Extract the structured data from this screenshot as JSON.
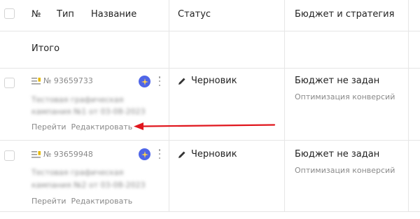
{
  "header": {
    "number_label": "№",
    "type_label": "Тип",
    "name_label": "Название",
    "status_label": "Статус",
    "budget_label": "Бюджет и стратегия"
  },
  "total_row": {
    "label": "Итого"
  },
  "campaigns": [
    {
      "id": "№ 93659733",
      "name_line1": "Тестовая графическая",
      "name_line2": "кампания №1 от 03-08-2023",
      "action_go": "Перейти",
      "action_edit": "Редактировать",
      "status": "Черновик",
      "budget": "Бюджет не задан",
      "strategy": "Оптимизация конверсий"
    },
    {
      "id": "№ 93659948",
      "name_line1": "Тестовая графическая",
      "name_line2": "кампания №2 от 03-08-2023",
      "action_go": "Перейти",
      "action_edit": "Редактировать",
      "status": "Черновик",
      "budget": "Бюджет не задан",
      "strategy": "Оптимизация конверсий"
    }
  ],
  "colors": {
    "accent_badge": "#4f66e8",
    "annotation_arrow": "#e0161d",
    "muted_text": "#8a8a8a"
  },
  "icons": {
    "row_type": "text-ad-icon",
    "ai_badge": "sparkle-icon",
    "menu": "kebab-menu-icon",
    "status": "pencil-icon"
  }
}
